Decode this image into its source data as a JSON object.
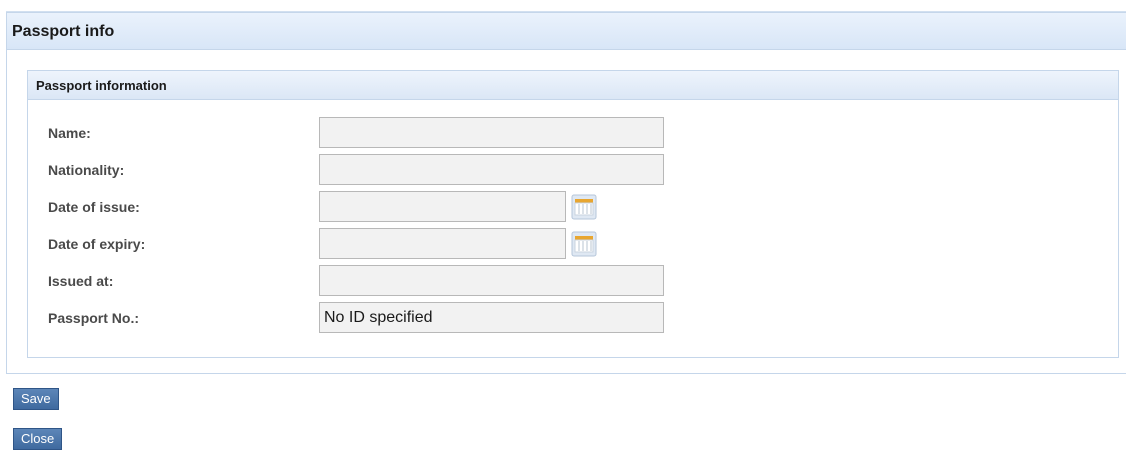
{
  "panel": {
    "title": "Passport info"
  },
  "fieldset": {
    "title": "Passport information"
  },
  "fields": [
    {
      "label": "Name:",
      "value": ""
    },
    {
      "label": "Nationality:",
      "value": ""
    },
    {
      "label": "Date of issue:",
      "value": ""
    },
    {
      "label": "Date of expiry:",
      "value": ""
    },
    {
      "label": "Issued at:",
      "value": ""
    },
    {
      "label": "Passport No.:",
      "value": "No ID specified"
    }
  ],
  "buttons": {
    "save_label": "Save",
    "close_label": "Close"
  },
  "colors": {
    "button_bg": "#4a74a8",
    "header_bg": "#dce8f7",
    "input_bg": "#f2f2f2"
  }
}
